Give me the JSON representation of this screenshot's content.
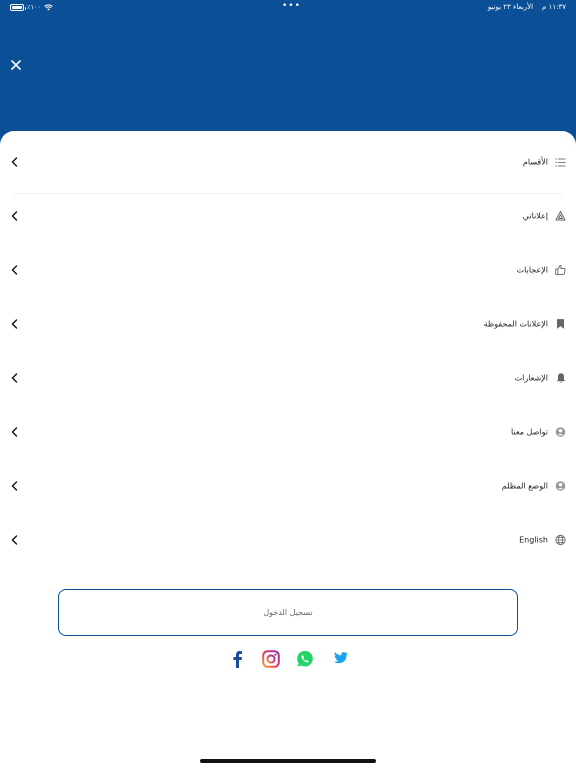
{
  "status_bar": {
    "time": "١١:٣٧ م",
    "date": "الأربعاء ٢٣ يونيو",
    "battery": "٪١٠٠"
  },
  "colors": {
    "brand": "#0b4f96",
    "divider": "#f0f0f0",
    "text": "#222222"
  },
  "menu": {
    "items": [
      {
        "label": "الأقسام",
        "icon": "list-icon"
      },
      {
        "label": "إعلاناتي",
        "icon": "ads-icon"
      },
      {
        "label": "الإعجابات",
        "icon": "thumb-up-icon"
      },
      {
        "label": "الإعلانات المحفوظة",
        "icon": "bookmark-icon"
      },
      {
        "label": "الإشعارات",
        "icon": "bell-icon"
      },
      {
        "label": "تواصل معنا",
        "icon": "contact-icon"
      },
      {
        "label": "الوضع المظلم",
        "icon": "dark-mode-icon"
      },
      {
        "label": "English",
        "icon": "globe-icon"
      }
    ]
  },
  "login": {
    "label": "تسجيل الدخول"
  },
  "social": [
    {
      "name": "facebook",
      "icon": "facebook-icon",
      "color": "#1f4b99"
    },
    {
      "name": "instagram",
      "icon": "instagram-icon",
      "color": "#e1306c"
    },
    {
      "name": "whatsapp",
      "icon": "whatsapp-icon",
      "color": "#25d366"
    },
    {
      "name": "twitter",
      "icon": "twitter-icon",
      "color": "#1da1f2"
    }
  ]
}
